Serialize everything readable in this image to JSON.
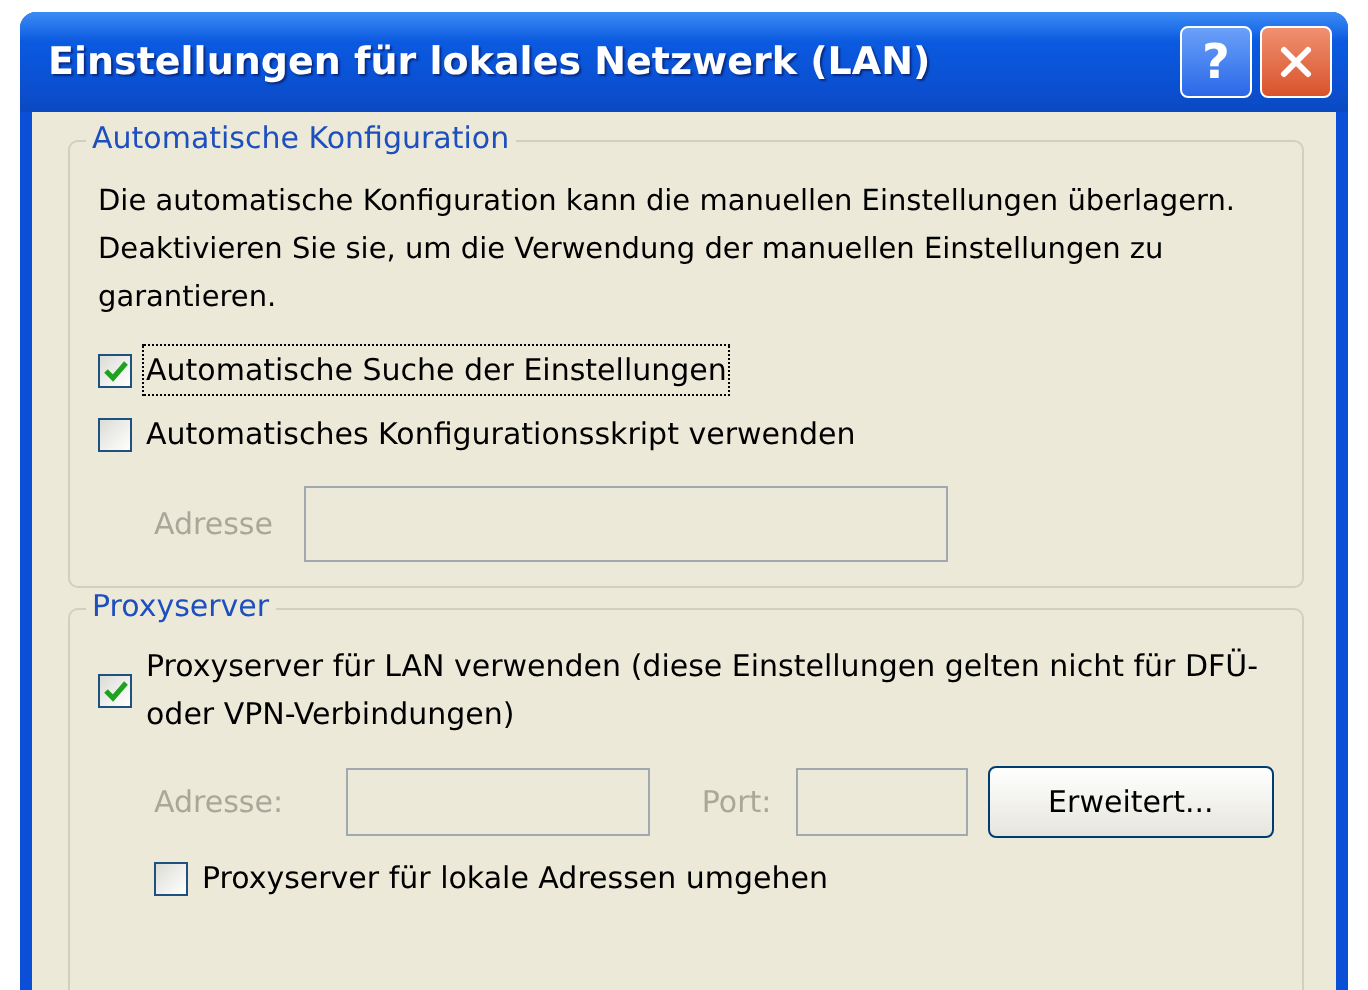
{
  "window": {
    "title": "Einstellungen für lokales Netzwerk (LAN)",
    "buttons": [
      {
        "kind": "help",
        "label": "?"
      },
      {
        "kind": "close"
      }
    ]
  },
  "auto_config": {
    "legend": "Automatische Konfiguration",
    "description": "Die automatische Konfiguration kann die manuellen Einstellungen überlagern. Deaktivieren Sie sie, um die Verwendung der manuellen Einstellungen zu garantieren.",
    "options": [
      {
        "label": "Automatische Suche der Einstellungen",
        "checked": true,
        "focused": true
      },
      {
        "label": "Automatisches Konfigurationsskript verwenden",
        "checked": false,
        "focused": false
      }
    ],
    "address": {
      "label": "Adresse",
      "disabled": true
    }
  },
  "proxy": {
    "legend": "Proxyserver",
    "use_proxy": {
      "label": "Proxyserver für LAN verwenden (diese Einstellungen gelten nicht für DFÜ- oder VPN-Verbindungen)",
      "checked": true
    },
    "address": {
      "label": "Adresse:",
      "disabled": true
    },
    "port": {
      "label": "Port:",
      "disabled": true
    },
    "advanced_button": {
      "label": "Erweitert..."
    },
    "bypass": {
      "label": "Proxyserver für lokale Adressen umgehen",
      "checked": false
    }
  }
}
